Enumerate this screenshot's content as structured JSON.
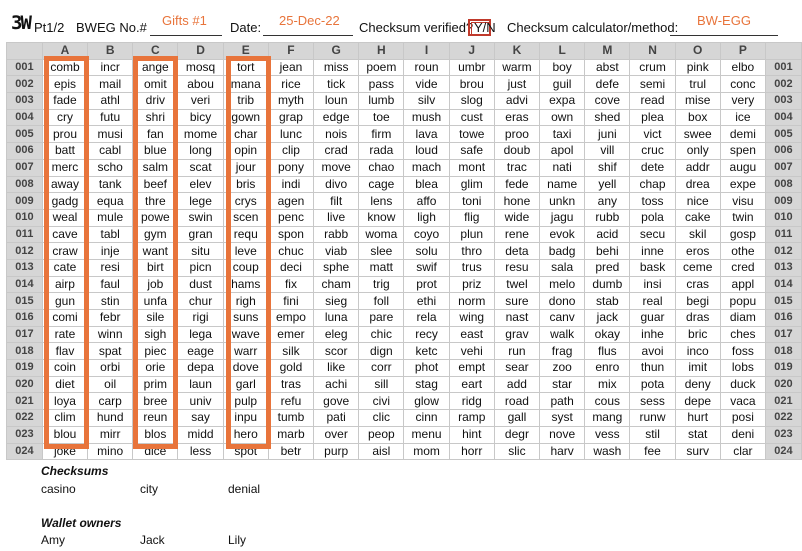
{
  "header": {
    "logo": "3W",
    "part": "Pt1/2",
    "bweg_label": "BWEG No.#",
    "bweg_value": "Gifts #1",
    "date_label": "Date:",
    "date_value": "25-Dec-22",
    "checksum_label": "Checksum verified?",
    "yn": "Y/N",
    "calc_label": "Checksum calculator/method:",
    "calc_value": "BW-EGG"
  },
  "columns": [
    "A",
    "B",
    "C",
    "D",
    "E",
    "F",
    "G",
    "H",
    "I",
    "J",
    "K",
    "L",
    "M",
    "N",
    "O",
    "P"
  ],
  "rows": [
    {
      "n": "001",
      "w": [
        "comb",
        "incr",
        "ange",
        "mosq",
        "tort",
        "jean",
        "miss",
        "poem",
        "roun",
        "umbr",
        "warm",
        "boy",
        "abst",
        "crum",
        "pink",
        "elbo"
      ]
    },
    {
      "n": "002",
      "w": [
        "epis",
        "mail",
        "omit",
        "abou",
        "mana",
        "rice",
        "tick",
        "pass",
        "vide",
        "brou",
        "just",
        "guil",
        "defe",
        "semi",
        "trul",
        "conc"
      ]
    },
    {
      "n": "003",
      "w": [
        "fade",
        "athl",
        "driv",
        "veri",
        "trib",
        "myth",
        "loun",
        "lumb",
        "silv",
        "slog",
        "advi",
        "expa",
        "cove",
        "read",
        "mise",
        "very"
      ]
    },
    {
      "n": "004",
      "w": [
        "cry",
        "futu",
        "shri",
        "bicy",
        "gown",
        "grap",
        "edge",
        "toe",
        "mush",
        "cust",
        "eras",
        "own",
        "shed",
        "plea",
        "box",
        "ice"
      ]
    },
    {
      "n": "005",
      "w": [
        "prou",
        "musi",
        "fan",
        "mome",
        "char",
        "lunc",
        "nois",
        "firm",
        "lava",
        "towe",
        "proo",
        "taxi",
        "juni",
        "vict",
        "swee",
        "demi"
      ]
    },
    {
      "n": "006",
      "w": [
        "batt",
        "cabl",
        "blue",
        "long",
        "opin",
        "clip",
        "crad",
        "rada",
        "loud",
        "safe",
        "doub",
        "apol",
        "vill",
        "cruc",
        "only",
        "spen"
      ]
    },
    {
      "n": "007",
      "w": [
        "merc",
        "scho",
        "salm",
        "scat",
        "jour",
        "pony",
        "move",
        "chao",
        "mach",
        "mont",
        "trac",
        "nati",
        "shif",
        "dete",
        "addr",
        "augu"
      ]
    },
    {
      "n": "008",
      "w": [
        "away",
        "tank",
        "beef",
        "elev",
        "bris",
        "indi",
        "divo",
        "cage",
        "blea",
        "glim",
        "fede",
        "name",
        "yell",
        "chap",
        "drea",
        "expe"
      ]
    },
    {
      "n": "009",
      "w": [
        "gadg",
        "equa",
        "thre",
        "lege",
        "crys",
        "agen",
        "filt",
        "lens",
        "affo",
        "toni",
        "hone",
        "unkn",
        "any",
        "toss",
        "nice",
        "visu"
      ]
    },
    {
      "n": "010",
      "w": [
        "weal",
        "mule",
        "powe",
        "swin",
        "scen",
        "penc",
        "live",
        "know",
        "ligh",
        "flig",
        "wide",
        "jagu",
        "rubb",
        "pola",
        "cake",
        "twin"
      ]
    },
    {
      "n": "011",
      "w": [
        "cave",
        "tabl",
        "gym",
        "gran",
        "requ",
        "spon",
        "rabb",
        "woma",
        "coyo",
        "plun",
        "rene",
        "evok",
        "acid",
        "secu",
        "skil",
        "gosp"
      ]
    },
    {
      "n": "012",
      "w": [
        "craw",
        "inje",
        "want",
        "situ",
        "leve",
        "chuc",
        "viab",
        "slee",
        "solu",
        "thro",
        "deta",
        "badg",
        "behi",
        "inne",
        "eros",
        "othe"
      ]
    },
    {
      "n": "013",
      "w": [
        "cate",
        "resi",
        "birt",
        "picn",
        "coup",
        "deci",
        "sphe",
        "matt",
        "swif",
        "trus",
        "resu",
        "sala",
        "pred",
        "bask",
        "ceme",
        "cred"
      ]
    },
    {
      "n": "014",
      "w": [
        "airp",
        "faul",
        "job",
        "dust",
        "hams",
        "fix",
        "cham",
        "trig",
        "prot",
        "priz",
        "twel",
        "melo",
        "dumb",
        "insi",
        "cras",
        "appl"
      ]
    },
    {
      "n": "015",
      "w": [
        "gun",
        "stin",
        "unfa",
        "chur",
        "righ",
        "fini",
        "sieg",
        "foll",
        "ethi",
        "norm",
        "sure",
        "dono",
        "stab",
        "real",
        "begi",
        "popu"
      ]
    },
    {
      "n": "016",
      "w": [
        "comi",
        "febr",
        "sile",
        "rigi",
        "suns",
        "empo",
        "luna",
        "pare",
        "rela",
        "wing",
        "nast",
        "canv",
        "jack",
        "guar",
        "dras",
        "diam"
      ]
    },
    {
      "n": "017",
      "w": [
        "rate",
        "winn",
        "sigh",
        "lega",
        "wave",
        "emer",
        "eleg",
        "chic",
        "recy",
        "east",
        "grav",
        "walk",
        "okay",
        "inhe",
        "bric",
        "ches"
      ]
    },
    {
      "n": "018",
      "w": [
        "flav",
        "spat",
        "piec",
        "eage",
        "warr",
        "silk",
        "scor",
        "dign",
        "ketc",
        "vehi",
        "run",
        "frag",
        "flus",
        "avoi",
        "inco",
        "foss"
      ]
    },
    {
      "n": "019",
      "w": [
        "coin",
        "orbi",
        "orie",
        "depa",
        "dove",
        "gold",
        "like",
        "corr",
        "phot",
        "empt",
        "sear",
        "zoo",
        "enro",
        "thun",
        "imit",
        "lobs"
      ]
    },
    {
      "n": "020",
      "w": [
        "diet",
        "oil",
        "prim",
        "laun",
        "garl",
        "tras",
        "achi",
        "sill",
        "stag",
        "eart",
        "add",
        "star",
        "mix",
        "pota",
        "deny",
        "duck"
      ]
    },
    {
      "n": "021",
      "w": [
        "loya",
        "carp",
        "bree",
        "univ",
        "pulp",
        "refu",
        "gove",
        "civi",
        "glow",
        "ridg",
        "road",
        "path",
        "cous",
        "sess",
        "depe",
        "vaca"
      ]
    },
    {
      "n": "022",
      "w": [
        "clim",
        "hund",
        "reun",
        "say",
        "inpu",
        "tumb",
        "pati",
        "clic",
        "cinn",
        "ramp",
        "gall",
        "syst",
        "mang",
        "runw",
        "hurt",
        "posi"
      ]
    },
    {
      "n": "023",
      "w": [
        "blou",
        "mirr",
        "blos",
        "midd",
        "hero",
        "marb",
        "over",
        "peop",
        "menu",
        "hint",
        "degr",
        "nove",
        "vess",
        "stil",
        "stat",
        "deni"
      ]
    },
    {
      "n": "024",
      "w": [
        "joke",
        "mino",
        "dice",
        "less",
        "spot",
        "betr",
        "purp",
        "aisl",
        "mom",
        "horr",
        "slic",
        "harv",
        "wash",
        "fee",
        "surv",
        "clar"
      ]
    }
  ],
  "checksums": {
    "title": "Checksums",
    "values": [
      "casino",
      "city",
      "denial"
    ]
  },
  "owners": {
    "title": "Wallet owners",
    "values": [
      "Amy",
      "Jack",
      "Lily"
    ]
  },
  "colors": {
    "highlight": "#e8743b",
    "header_bg": "#d6d6d6",
    "yn_box": "#c0392b"
  }
}
